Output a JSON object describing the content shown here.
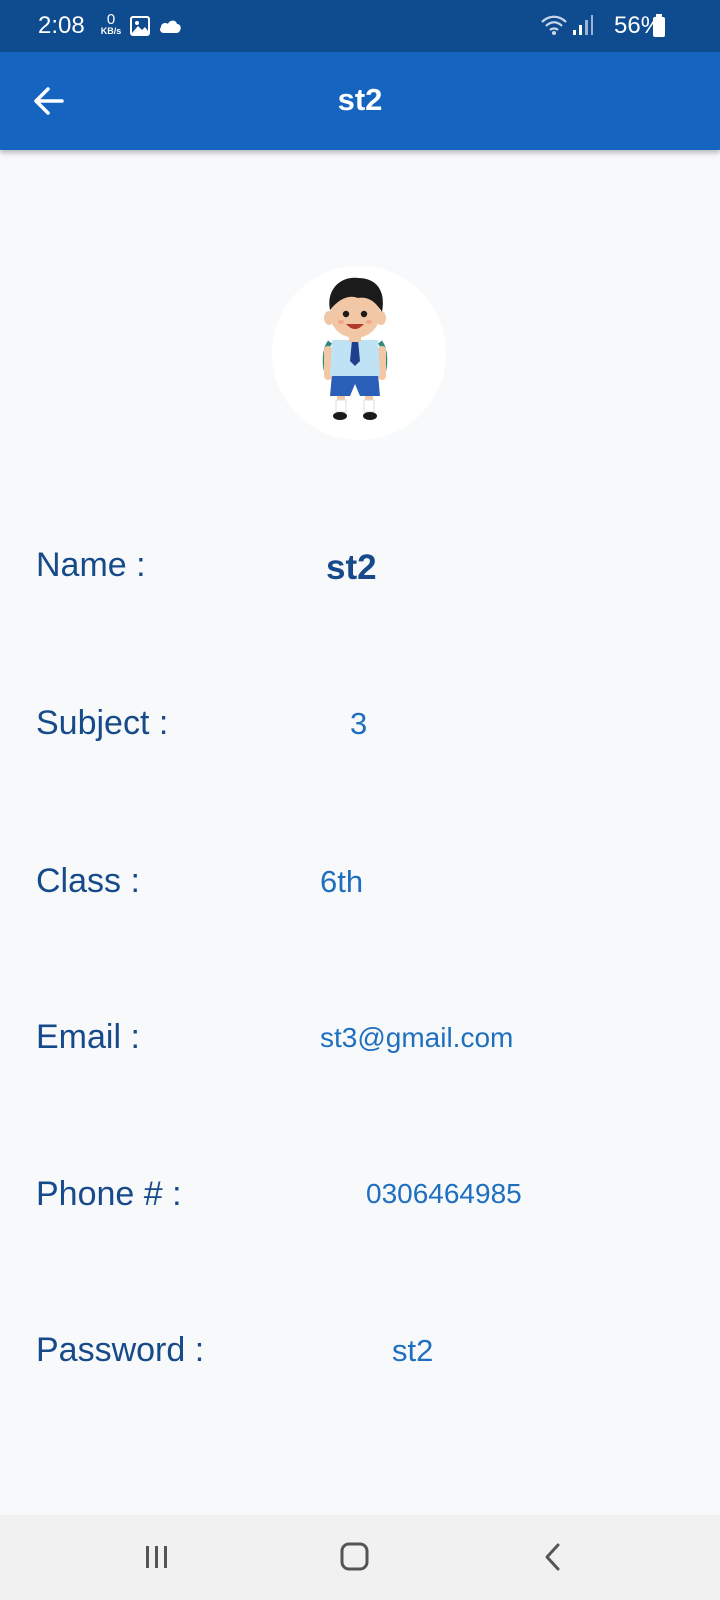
{
  "status_bar": {
    "time": "2:08",
    "net_speed_value": "0",
    "net_speed_unit": "KB/s",
    "battery": "56%",
    "icons": [
      "gallery-icon",
      "cloud-icon",
      "wifi-icon",
      "signal-icon",
      "battery-icon"
    ]
  },
  "app_bar": {
    "title": "st2",
    "back_icon": "arrow-left-icon"
  },
  "profile": {
    "avatar": "student-boy-avatar",
    "fields": [
      {
        "label": "Name :",
        "value": "st2"
      },
      {
        "label": "Subject :",
        "value": "3"
      },
      {
        "label": "Class :",
        "value": "6th"
      },
      {
        "label": "Email :",
        "value": "st3@gmail.com"
      },
      {
        "label": "Phone # :",
        "value": "0306464985"
      },
      {
        "label": "Password :",
        "value": "st2"
      }
    ]
  },
  "nav_bar": {
    "recents_icon": "recents-icon",
    "home_icon": "home-icon",
    "back_icon": "back-chevron-icon"
  },
  "colors": {
    "status_bar": "#0f4c8f",
    "app_bar": "#1565c0",
    "label": "#174a8b",
    "value": "#1f6fc0",
    "background": "#f8f9fa"
  }
}
